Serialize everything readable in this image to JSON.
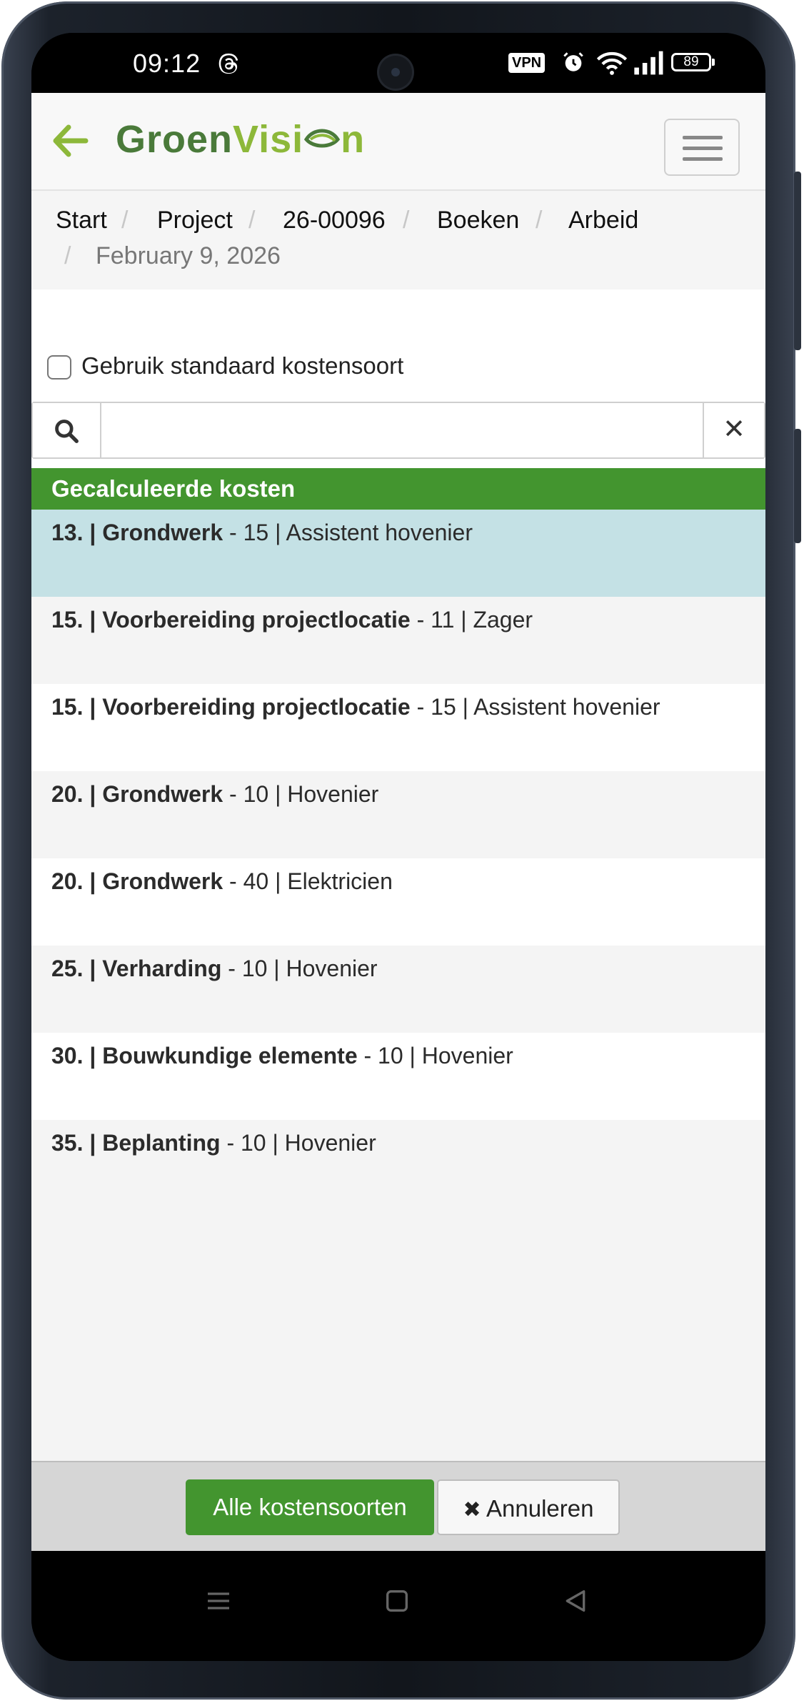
{
  "status_bar": {
    "time": "09:12",
    "vpn": "VPN",
    "battery": "89",
    "icons": [
      "threads-icon",
      "alarm-icon",
      "wifi-icon",
      "signal-icon",
      "battery-icon"
    ]
  },
  "header": {
    "logo_part1": "Groen",
    "logo_part2": "Visi",
    "logo_part3": "n",
    "back_icon": "arrow-left-icon",
    "menu_icon": "hamburger-icon"
  },
  "breadcrumb": {
    "items": [
      "Start",
      "Project",
      "26-00096",
      "Boeken",
      "Arbeid"
    ],
    "separator": "/",
    "active": "February 9, 2026"
  },
  "options": {
    "checkbox_label": "Gebruik standaard kostensoort",
    "checked": false
  },
  "search": {
    "value": "",
    "placeholder": "",
    "clear_label": "✕"
  },
  "section": {
    "title": "Gecalculeerde kosten"
  },
  "rows": [
    {
      "code": "13. | Grondwerk",
      "detail": " - 15 | Assistent hovenier",
      "selected": true
    },
    {
      "code": "15. | Voorbereiding projectlocatie",
      "detail": " - 11 | Zager",
      "selected": false
    },
    {
      "code": "15. | Voorbereiding projectlocatie",
      "detail": " - 15 | Assistent hovenier",
      "selected": false
    },
    {
      "code": "20. | Grondwerk",
      "detail": " - 10 | Hovenier",
      "selected": false
    },
    {
      "code": "20. | Grondwerk",
      "detail": " - 40 | Elektricien",
      "selected": false
    },
    {
      "code": "25. | Verharding",
      "detail": " - 10 | Hovenier",
      "selected": false
    },
    {
      "code": "30. | Bouwkundige elemente",
      "detail": " - 10 | Hovenier",
      "selected": false
    },
    {
      "code": "35. | Beplanting",
      "detail": " - 10 | Hovenier",
      "selected": false
    }
  ],
  "footer": {
    "all_button": "Alle kostensoorten",
    "cancel_button": "Annuleren",
    "cancel_icon": "✖"
  },
  "colors": {
    "brand_green": "#43952f",
    "selected_row": "#c4e1e5",
    "row_alt": "#f4f4f4",
    "row_white": "#ffffff"
  }
}
